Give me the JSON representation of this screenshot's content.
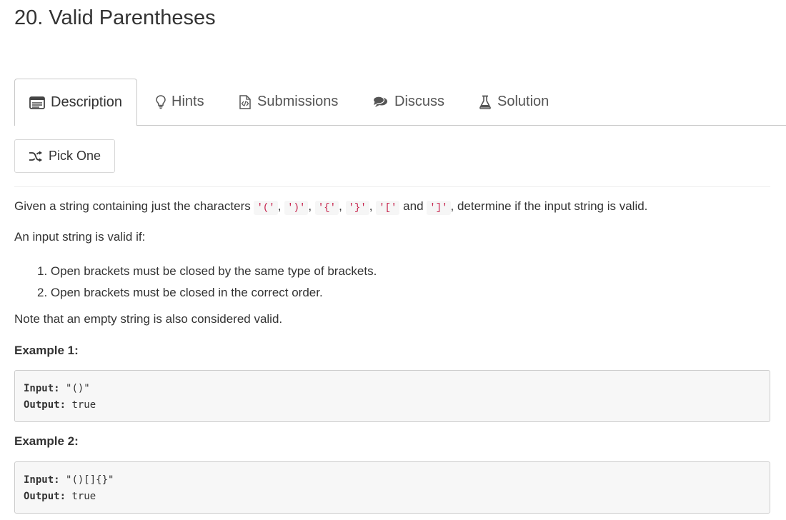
{
  "problem": {
    "title": "20. Valid Parentheses"
  },
  "tabs": [
    {
      "label": "Description",
      "icon": "description-icon",
      "active": true
    },
    {
      "label": "Hints",
      "icon": "lightbulb-icon"
    },
    {
      "label": "Submissions",
      "icon": "code-file-icon"
    },
    {
      "label": "Discuss",
      "icon": "comments-icon"
    },
    {
      "label": "Solution",
      "icon": "flask-icon"
    }
  ],
  "pick_one": {
    "label": "Pick One",
    "icon": "shuffle-icon"
  },
  "description": {
    "intro_before": "Given a string containing just the characters",
    "chars": [
      "'('",
      "')'",
      "'{'",
      "'}'",
      "'['",
      "']'"
    ],
    "sep": ",",
    "and_word": "and",
    "intro_after": ", determine if the input string is valid.",
    "valid_if": "An input string is valid if:",
    "rules": [
      "1. Open brackets must be closed by the same type of brackets.",
      "2. Open brackets must be closed in the correct order."
    ],
    "note": "Note that an empty string is also considered valid."
  },
  "examples": [
    {
      "heading": "Example 1:",
      "input_label": "Input:",
      "input_value": "\"()\"",
      "output_label": "Output:",
      "output_value": "true"
    },
    {
      "heading": "Example 2:",
      "input_label": "Input:",
      "input_value": "\"()[]{}\"",
      "output_label": "Output:",
      "output_value": "true"
    }
  ],
  "colors": {
    "code_text": "#c7254e",
    "border": "#c9c9c9",
    "pre_bg": "#f7f7f7"
  }
}
